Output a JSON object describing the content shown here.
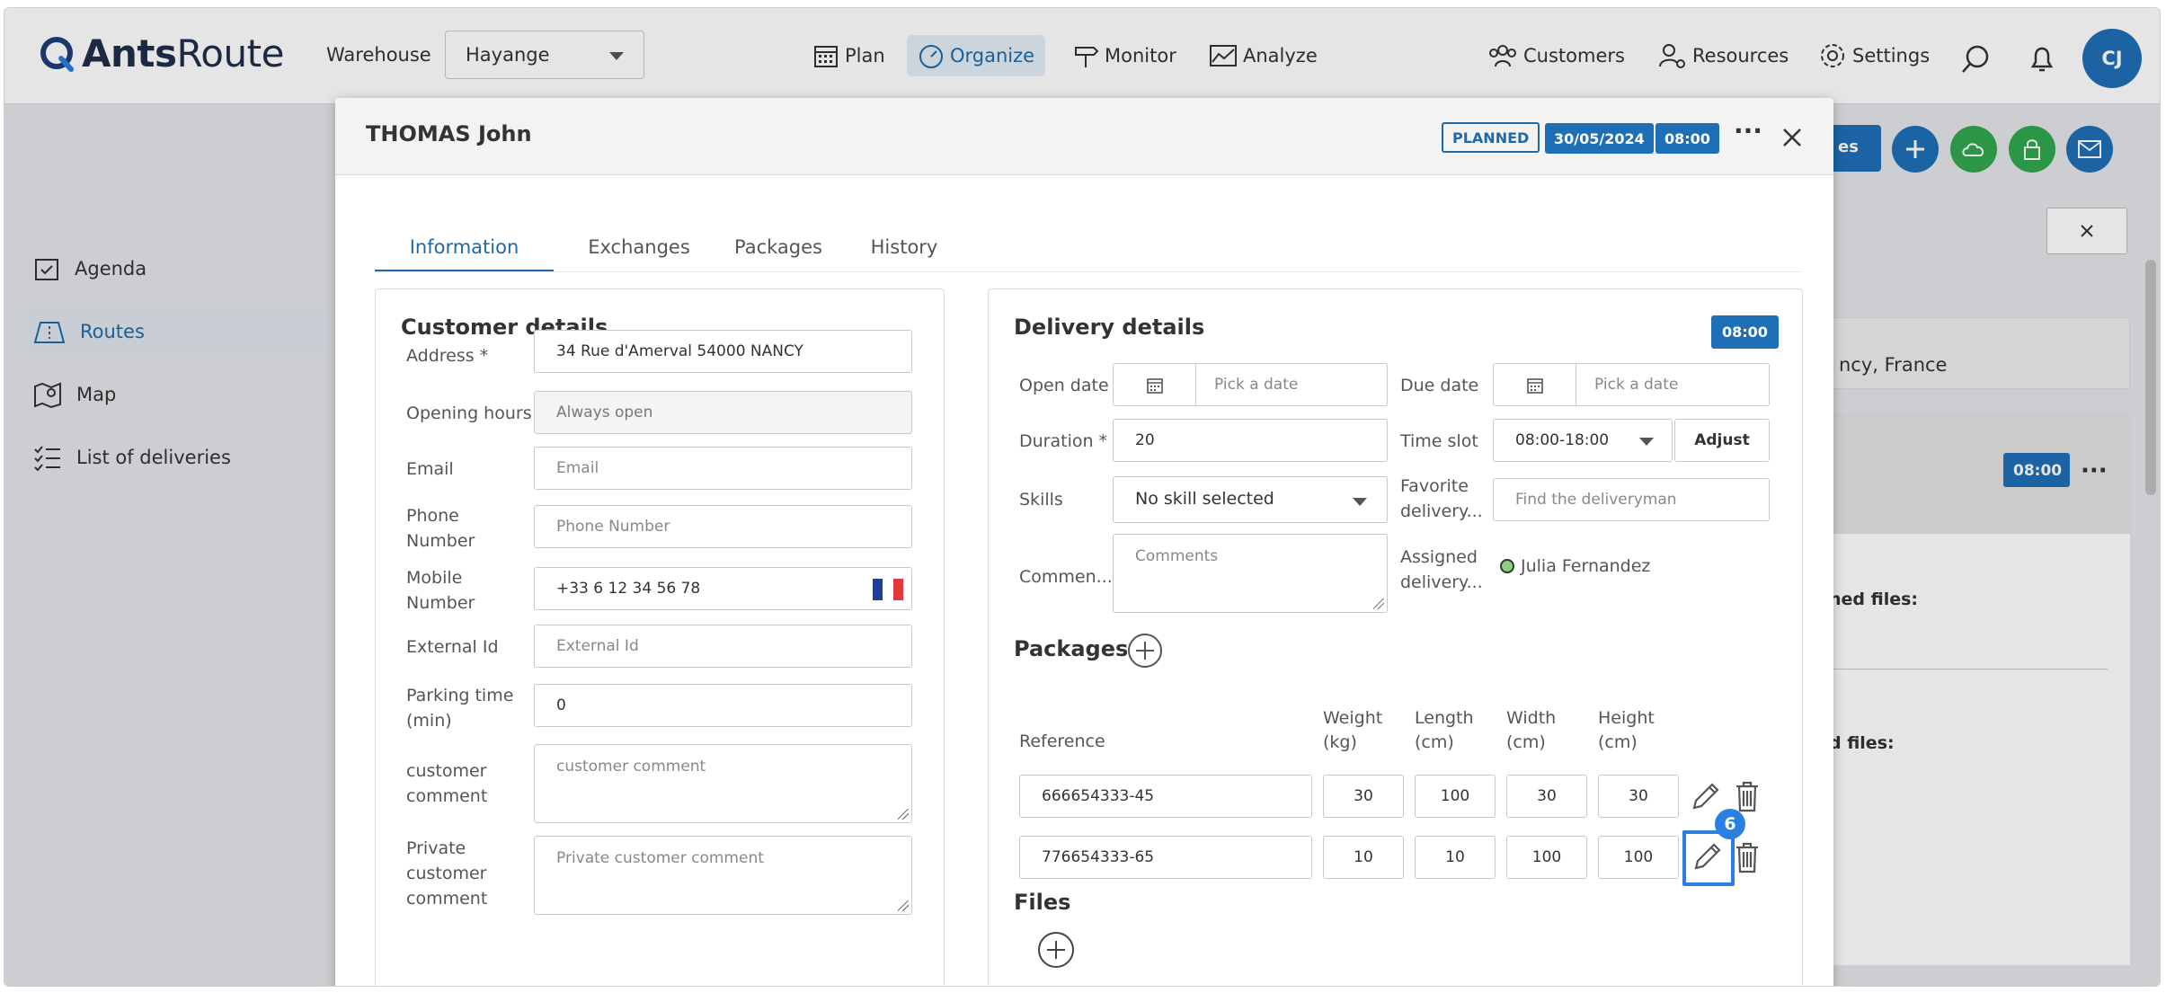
{
  "app": {
    "logo_bold": "Ants",
    "logo_light": "Route",
    "avatar_initials": "CJ"
  },
  "topbar": {
    "warehouse_label": "Warehouse",
    "warehouse_value": "Hayange",
    "nav": {
      "plan": "Plan",
      "organize": "Organize",
      "monitor": "Monitor",
      "analyze": "Analyze",
      "customers": "Customers",
      "resources": "Resources",
      "settings": "Settings"
    }
  },
  "sidebar": {
    "agenda": "Agenda",
    "routes": "Routes",
    "map": "Map",
    "list": "List of deliveries"
  },
  "background": {
    "address_fragment": "ncy, France",
    "time_badge": "08:00",
    "files_fragment_1": "ned files:",
    "files_fragment_2": "d files:",
    "btn_fragment": "es"
  },
  "modal": {
    "title": "THOMAS John",
    "status": "PLANNED",
    "date": "30/05/2024",
    "time": "08:00",
    "tabs": [
      "Information",
      "Exchanges",
      "Packages",
      "History"
    ],
    "customer": {
      "title": "Customer details",
      "address_label": "Address *",
      "address_value": "34 Rue d'Amerval 54000 NANCY",
      "opening_label": "Opening hours",
      "opening_value": "Always open",
      "email_label": "Email",
      "email_placeholder": "Email",
      "phone_label_1": "Phone",
      "phone_label_2": "Number",
      "phone_placeholder": "Phone Number",
      "mobile_label_1": "Mobile",
      "mobile_label_2": "Number",
      "mobile_value": "+33 6 12 34 56 78",
      "external_label": "External Id",
      "external_placeholder": "External Id",
      "parking_label_1": "Parking time",
      "parking_label_2": "(min)",
      "parking_value": "0",
      "comment_label_1": "customer",
      "comment_label_2": "comment",
      "comment_placeholder": "customer comment",
      "private_label_1": "Private",
      "private_label_2": "customer",
      "private_label_3": "comment",
      "private_placeholder": "Private customer comment"
    },
    "delivery": {
      "title": "Delivery details",
      "time_badge": "08:00",
      "open_label": "Open date",
      "open_placeholder": "Pick a date",
      "due_label": "Due date",
      "due_placeholder": "Pick a date",
      "duration_label": "Duration *",
      "duration_value": "20",
      "timeslot_label": "Time slot",
      "timeslot_value": "08:00-18:00",
      "adjust_label": "Adjust",
      "skills_label": "Skills",
      "skills_value": "No skill selected",
      "favorite_label_1": "Favorite",
      "favorite_label_2": "delivery...",
      "favorite_placeholder": "Find the deliveryman",
      "comment_label": "Commen...",
      "comment_placeholder": "Comments",
      "assigned_label_1": "Assigned",
      "assigned_label_2": "delivery...",
      "assigned_value": "Julia Fernandez"
    },
    "packages": {
      "title": "Packages",
      "headers": {
        "reference": "Reference",
        "weight_1": "Weight",
        "weight_2": "(kg)",
        "length_1": "Length",
        "length_2": "(cm)",
        "width_1": "Width",
        "width_2": "(cm)",
        "height_1": "Height",
        "height_2": "(cm)"
      },
      "rows": [
        {
          "reference": "666654333-45",
          "weight": "30",
          "length": "100",
          "width": "30",
          "height": "30"
        },
        {
          "reference": "776654333-65",
          "weight": "10",
          "length": "10",
          "width": "100",
          "height": "100"
        }
      ],
      "highlight_marker": "6"
    },
    "files": {
      "title": "Files"
    }
  }
}
